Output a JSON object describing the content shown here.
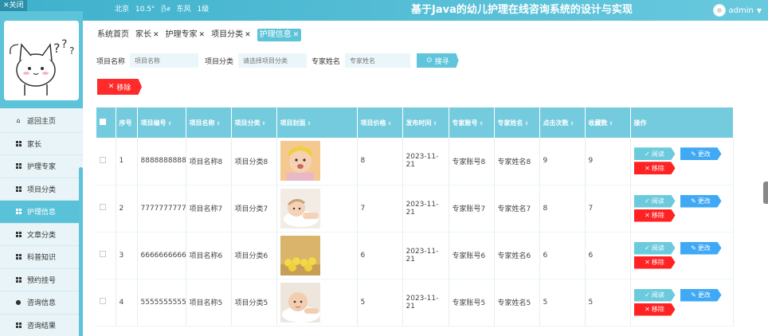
{
  "header": {
    "close_label": "✕关闭",
    "weather": {
      "city": "北京",
      "temp": "10.5°",
      "wind_icon": "🌬",
      "wind": "东风",
      "level": "1级"
    },
    "title": "基于Java的幼儿护理在线咨询系统的设计与实现",
    "user": "admin"
  },
  "sidebar": {
    "username": "admin",
    "items": [
      {
        "label": "返回主页",
        "icon": "home-icon"
      },
      {
        "label": "家长",
        "icon": "grid-icon"
      },
      {
        "label": "护理专家",
        "icon": "grid-icon"
      },
      {
        "label": "项目分类",
        "icon": "grid-icon"
      },
      {
        "label": "护理信息",
        "icon": "grid-icon",
        "active": true
      },
      {
        "label": "文章分类",
        "icon": "grid-icon"
      },
      {
        "label": "科普知识",
        "icon": "grid-icon"
      },
      {
        "label": "预约挂号",
        "icon": "grid-icon"
      },
      {
        "label": "咨询信息",
        "icon": "user-icon"
      },
      {
        "label": "咨询结果",
        "icon": "grid-icon"
      }
    ]
  },
  "tabs": [
    {
      "label": "系统首页",
      "closable": false
    },
    {
      "label": "家长",
      "closable": true
    },
    {
      "label": "护理专家",
      "closable": true
    },
    {
      "label": "项目分类",
      "closable": true
    },
    {
      "label": "护理信息",
      "closable": true,
      "active": true
    }
  ],
  "search": {
    "name_label": "项目名称",
    "name_placeholder": "项目名称",
    "category_label": "项目分类",
    "category_placeholder": "请选择项目分类",
    "expert_label": "专家姓名",
    "expert_placeholder": "专家姓名",
    "button": "搜寻"
  },
  "toolbar": {
    "remove": "移除"
  },
  "table": {
    "headers": [
      "序号",
      "项目编号",
      "项目名称",
      "项目分类",
      "项目封面",
      "项目价格",
      "发布时间",
      "专家账号",
      "专家姓名",
      "点击次数",
      "收藏数",
      "操作"
    ],
    "rows": [
      {
        "idx": "1",
        "code": "8888888888",
        "name": "项目名称8",
        "category": "项目分类8",
        "price": "8",
        "date": "2023-11-21",
        "account": "专家账号8",
        "expert": "专家姓名8",
        "clicks": "9",
        "favs": "9"
      },
      {
        "idx": "2",
        "code": "7777777777",
        "name": "项目名称7",
        "category": "项目分类7",
        "price": "7",
        "date": "2023-11-21",
        "account": "专家账号7",
        "expert": "专家姓名7",
        "clicks": "8",
        "favs": "7"
      },
      {
        "idx": "3",
        "code": "6666666666",
        "name": "项目名称6",
        "category": "项目分类6",
        "price": "6",
        "date": "2023-11-21",
        "account": "专家账号6",
        "expert": "专家姓名6",
        "clicks": "6",
        "favs": "6"
      },
      {
        "idx": "4",
        "code": "5555555555",
        "name": "项目名称5",
        "category": "项目分类5",
        "price": "5",
        "date": "2023-11-21",
        "account": "专家账号5",
        "expert": "专家姓名5",
        "clicks": "5",
        "favs": "5"
      }
    ],
    "ops": {
      "read": "阅读",
      "edit": "更改",
      "del": "移除"
    }
  }
}
